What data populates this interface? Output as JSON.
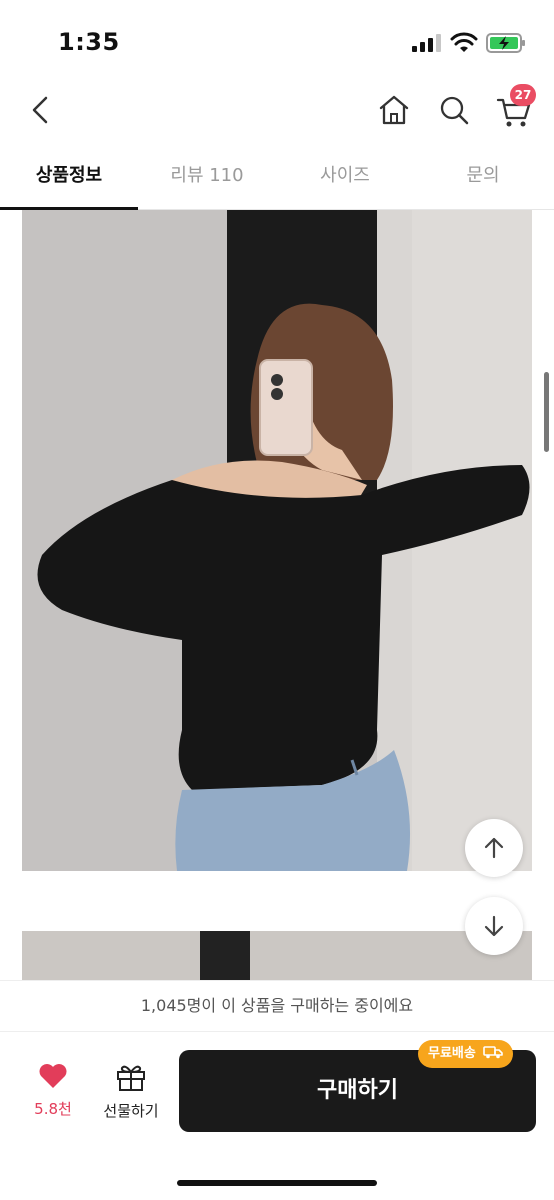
{
  "status_bar": {
    "time": "1:35"
  },
  "header": {
    "cart_count": "27",
    "icons": [
      "back-icon",
      "home-icon",
      "search-icon",
      "cart-icon"
    ]
  },
  "tabs": [
    {
      "label": "상품정보",
      "active": true
    },
    {
      "label": "리뷰 110",
      "active": false
    },
    {
      "label": "사이즈",
      "active": false
    },
    {
      "label": "문의",
      "active": false
    }
  ],
  "notice": {
    "text": "1,045명이 이 상품을 구매하는 중이에요"
  },
  "bottom_bar": {
    "like_count": "5.8천",
    "gift_label": "선물하기",
    "buy_label": "구매하기",
    "free_shipping_badge": "무료배송"
  },
  "colors": {
    "accent": "#e23d5a",
    "badge": "#f7a51c",
    "buy_button": "#1a1a1a"
  }
}
